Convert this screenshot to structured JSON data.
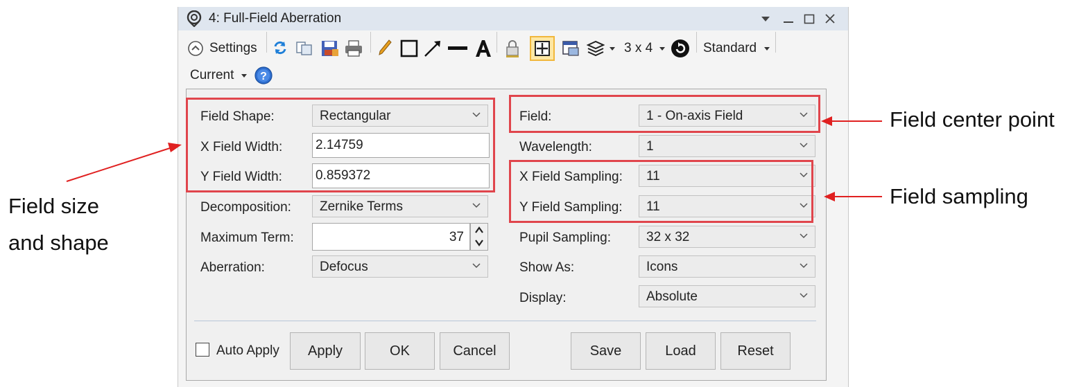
{
  "window": {
    "title": "4: Full-Field Aberration"
  },
  "toolbar": {
    "settings_label": "Settings",
    "grid_label": "3 x 4",
    "standard_label": "Standard",
    "current_label": "Current"
  },
  "left_fields": {
    "field_shape": {
      "label": "Field Shape:",
      "value": "Rectangular"
    },
    "x_field_width": {
      "label": "X Field Width:",
      "value": "2.14759"
    },
    "y_field_width": {
      "label": "Y Field Width:",
      "value": "0.859372"
    },
    "decomposition": {
      "label": "Decomposition:",
      "value": "Zernike Terms"
    },
    "maximum_term": {
      "label": "Maximum Term:",
      "value": "37"
    },
    "aberration": {
      "label": "Aberration:",
      "value": "Defocus"
    }
  },
  "right_fields": {
    "field": {
      "label": "Field:",
      "value": "1 - On-axis Field"
    },
    "wavelength": {
      "label": "Wavelength:",
      "value": "1"
    },
    "x_field_sampling": {
      "label": "X Field Sampling:",
      "value": "11"
    },
    "y_field_sampling": {
      "label": "Y Field Sampling:",
      "value": "11"
    },
    "pupil_sampling": {
      "label": "Pupil Sampling:",
      "value": "32 x 32"
    },
    "show_as": {
      "label": "Show As:",
      "value": "Icons"
    },
    "display": {
      "label": "Display:",
      "value": "Absolute"
    }
  },
  "buttons": {
    "auto_apply": "Auto Apply",
    "apply": "Apply",
    "ok": "OK",
    "cancel": "Cancel",
    "save": "Save",
    "load": "Load",
    "reset": "Reset"
  },
  "annotations": {
    "field_size_line1": "Field size",
    "field_size_line2": "and shape",
    "field_center": "Field center point",
    "field_sampling": "Field sampling"
  },
  "colors": {
    "highlight": "#e0454c",
    "arrow": "#e02020",
    "titlebar": "#dfe6ef"
  },
  "icons": [
    "app-icon",
    "minimize-icon",
    "maximize-icon",
    "close-icon",
    "collapse-icon",
    "refresh-icon",
    "copy-icon",
    "save-icon",
    "print-icon",
    "pencil-icon",
    "rectangle-icon",
    "arrow-icon",
    "line-icon",
    "text-icon",
    "lock-icon",
    "grid-icon",
    "window-icon",
    "layers-icon",
    "rotate-icon",
    "help-icon"
  ]
}
